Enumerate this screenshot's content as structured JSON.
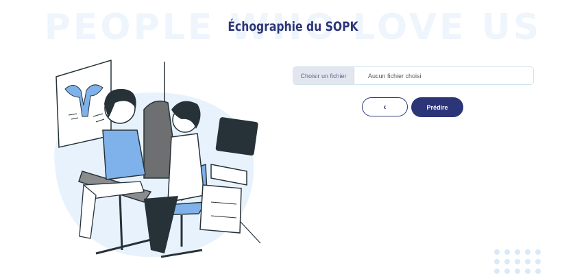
{
  "watermark": "PEOPLE WHO LOVE US",
  "page": {
    "title": "Échographie du SOPK"
  },
  "form": {
    "file_button_label": "Choisir un fichier",
    "file_status": "Aucun fichier choisi",
    "back_label": "‹",
    "predict_label": "Prédire"
  },
  "colors": {
    "primary": "#2c3578",
    "accent_blue": "#7fb2ea",
    "blob": "#e8f2fd"
  },
  "icons": {
    "back": "chevron-left-icon"
  }
}
